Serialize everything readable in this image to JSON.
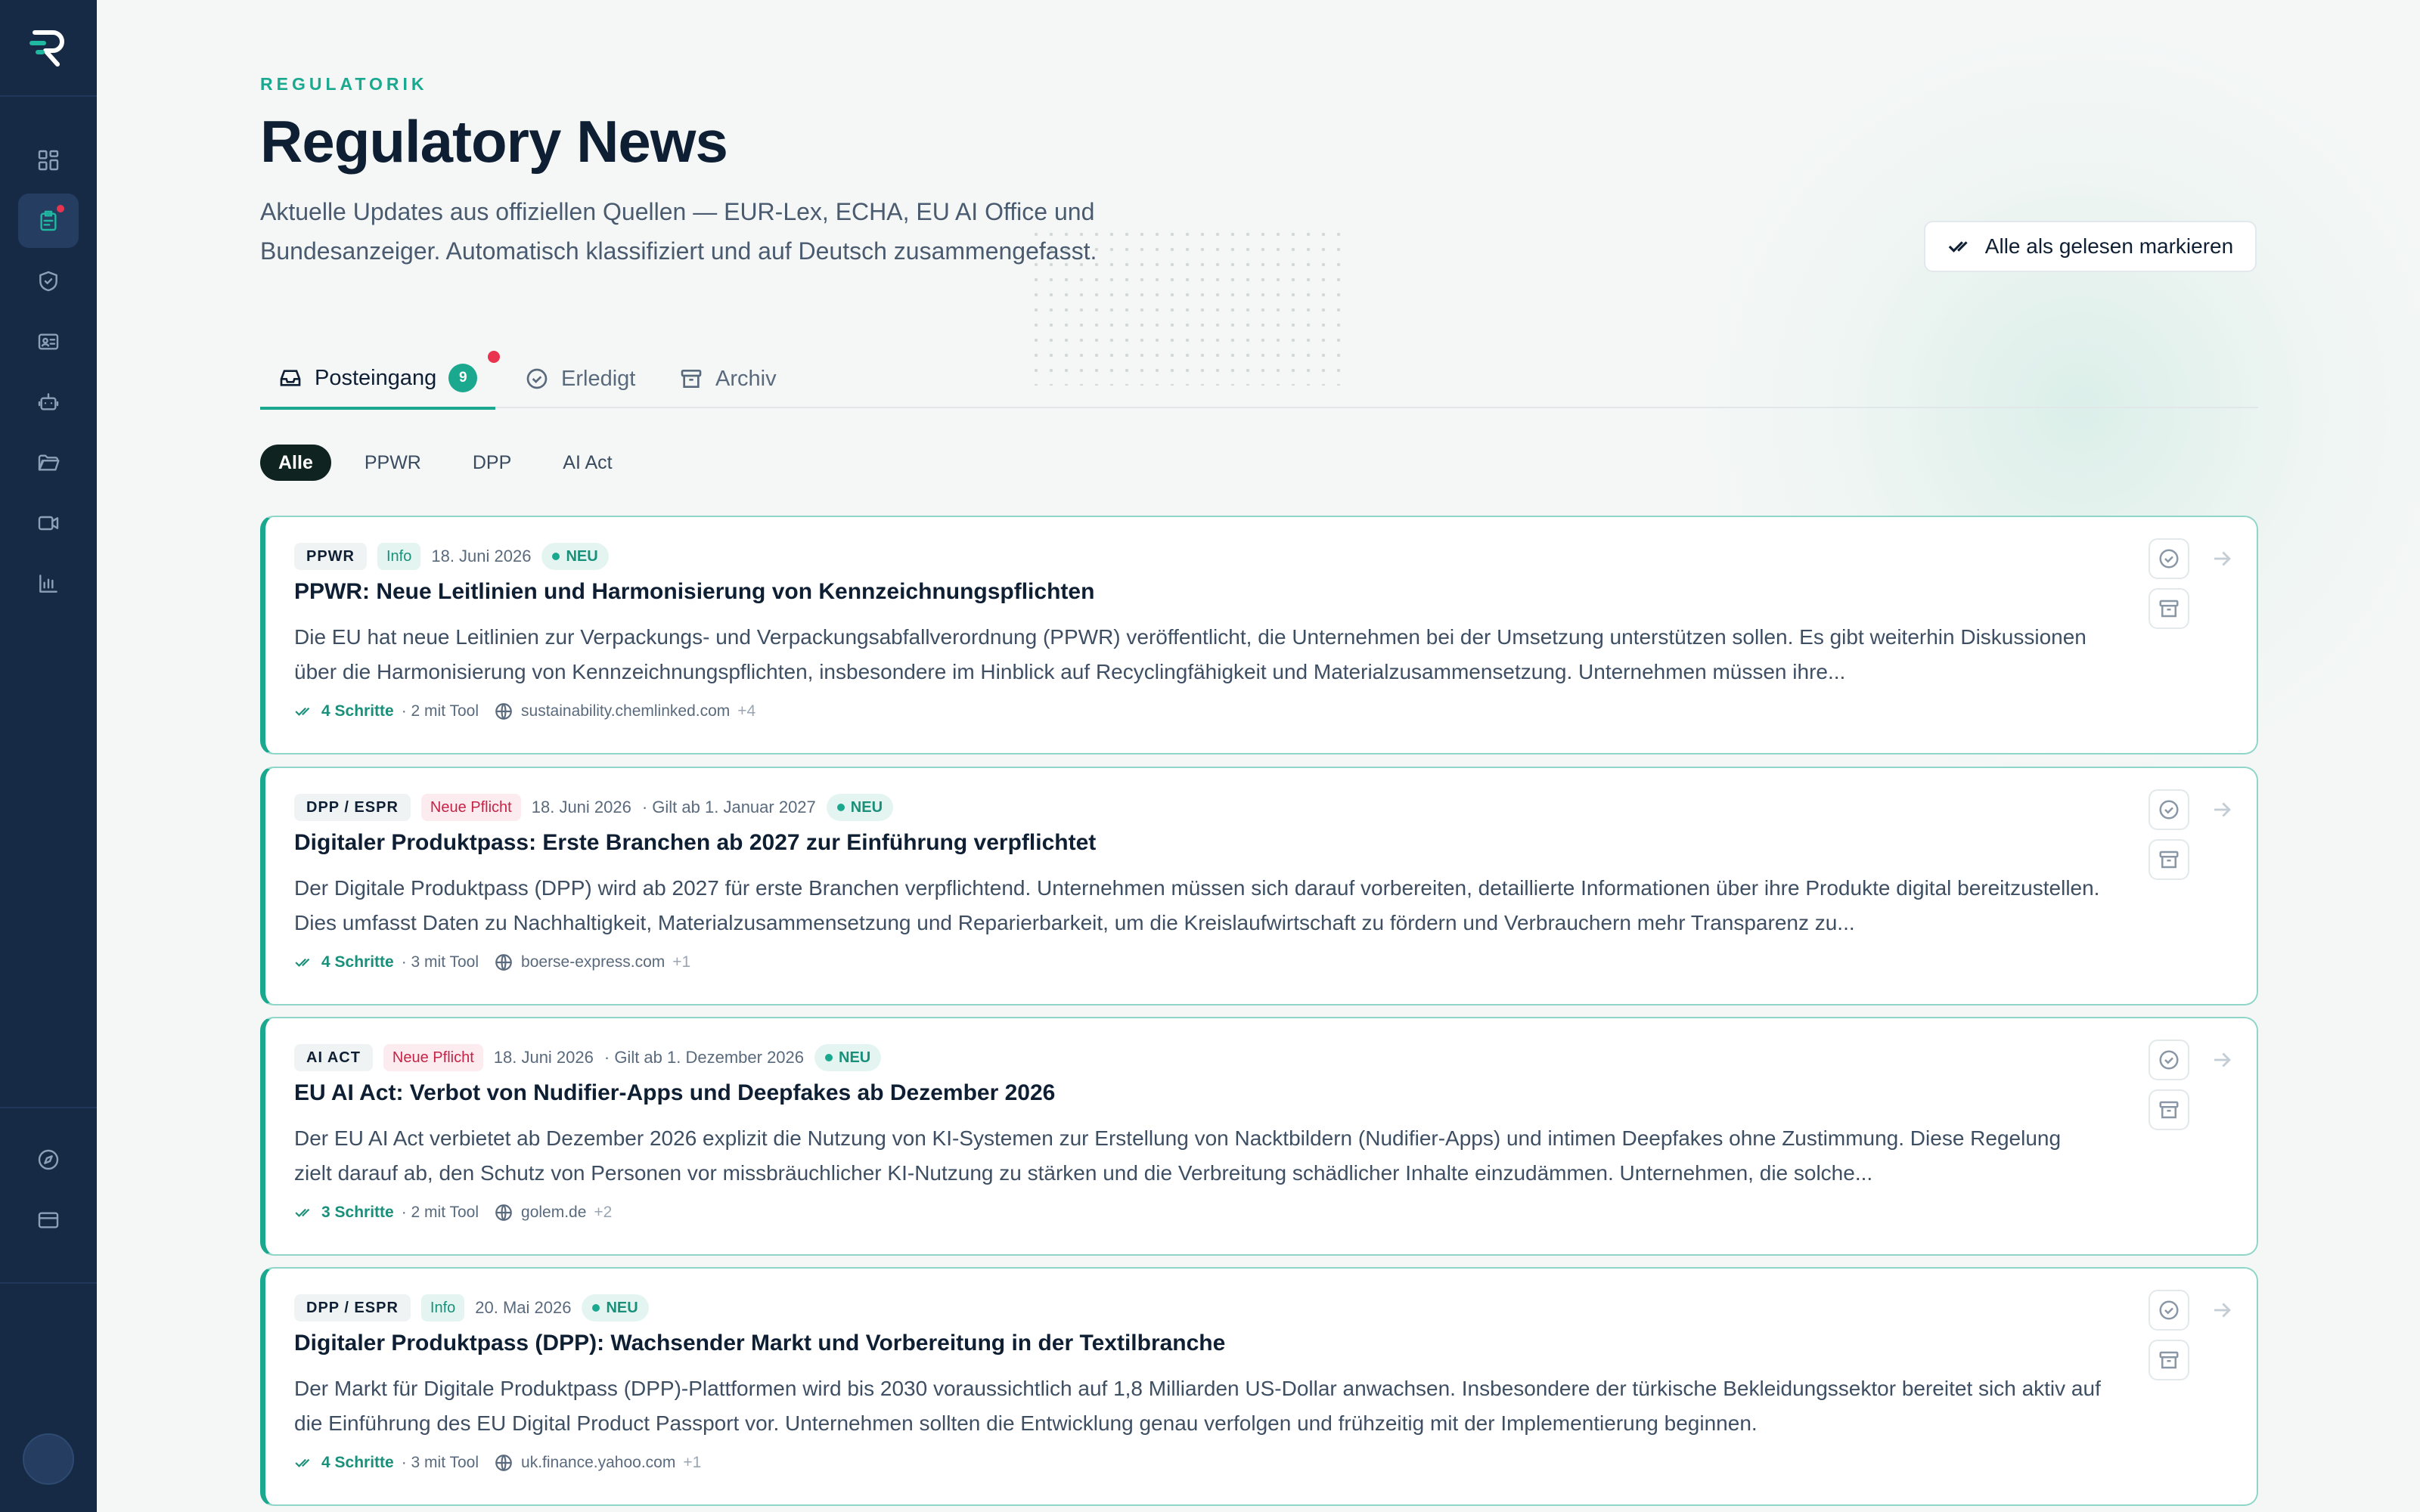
{
  "header": {
    "eyebrow": "REGULATORIK",
    "title": "Regulatory News",
    "subtitle": "Aktuelle Updates aus offiziellen Quellen — EUR-Lex, ECHA, EU AI Office und Bundesanzeiger. Automatisch klassifiziert und auf Deutsch zusammengefasst.",
    "mark_all_label": "Alle als gelesen markieren"
  },
  "tabs": [
    {
      "label": "Posteingang",
      "badge": "9",
      "icon": "inbox-icon"
    },
    {
      "label": "Erledigt",
      "icon": "check-circle-icon"
    },
    {
      "label": "Archiv",
      "icon": "archive-icon"
    }
  ],
  "filters": [
    "Alle",
    "PPWR",
    "DPP",
    "AI Act"
  ],
  "cards": [
    {
      "tag": "PPWR",
      "type": "Info",
      "date": "18. Juni 2026",
      "gilt": "",
      "status": "NEU",
      "title": "PPWR: Neue Leitlinien und Harmonisierung von Kennzeichnungspflichten",
      "desc": "Die EU hat neue Leitlinien zur Verpackungs- und Verpackungsabfallverordnung (PPWR) veröffentlicht, die Unternehmen bei der Umsetzung unterstützen sollen. Es gibt weiterhin Diskussionen über die Harmonisierung von Kennzeichnungspflichten, insbesondere im Hinblick auf Recyclingfähigkeit und Materialzusammensetzung. Unternehmen müssen ihre...",
      "steps": "4 Schritte",
      "tool": "· 2 mit Tool",
      "source": "sustainability.chemlinked.com",
      "more": "+4"
    },
    {
      "tag": "DPP / ESPR",
      "type": "Neue Pflicht",
      "date": "18. Juni 2026",
      "gilt": "· Gilt ab 1. Januar 2027",
      "status": "NEU",
      "title": "Digitaler Produktpass: Erste Branchen ab 2027 zur Einführung verpflichtet",
      "desc": "Der Digitale Produktpass (DPP) wird ab 2027 für erste Branchen verpflichtend. Unternehmen müssen sich darauf vorbereiten, detaillierte Informationen über ihre Produkte digital bereitzustellen. Dies umfasst Daten zu Nachhaltigkeit, Materialzusammensetzung und Reparierbarkeit, um die Kreislaufwirtschaft zu fördern und Verbrauchern mehr Transparenz zu...",
      "steps": "4 Schritte",
      "tool": "· 3 mit Tool",
      "source": "boerse-express.com",
      "more": "+1"
    },
    {
      "tag": "AI ACT",
      "type": "Neue Pflicht",
      "date": "18. Juni 2026",
      "gilt": "· Gilt ab 1. Dezember 2026",
      "status": "NEU",
      "title": "EU AI Act: Verbot von Nudifier-Apps und Deepfakes ab Dezember 2026",
      "desc": "Der EU AI Act verbietet ab Dezember 2026 explizit die Nutzung von KI-Systemen zur Erstellung von Nacktbildern (Nudifier-Apps) und intimen Deepfakes ohne Zustimmung. Diese Regelung zielt darauf ab, den Schutz von Personen vor missbräuchlicher KI-Nutzung zu stärken und die Verbreitung schädlicher Inhalte einzudämmen. Unternehmen, die solche...",
      "steps": "3 Schritte",
      "tool": "· 2 mit Tool",
      "source": "golem.de",
      "more": "+2"
    },
    {
      "tag": "DPP / ESPR",
      "type": "Info",
      "date": "20. Mai 2026",
      "gilt": "",
      "status": "NEU",
      "title": "Digitaler Produktpass (DPP): Wachsender Markt und Vorbereitung in der Textilbranche",
      "desc": "Der Markt für Digitale Produktpass (DPP)-Plattformen wird bis 2030 voraussichtlich auf 1,8 Milliarden US-Dollar anwachsen. Insbesondere der türkische Bekleidungssektor bereitet sich aktiv auf die Einführung des EU Digital Product Passport vor. Unternehmen sollten die Entwicklung genau verfolgen und frühzeitig mit der Implementierung beginnen.",
      "steps": "4 Schritte",
      "tool": "· 3 mit Tool",
      "source": "uk.finance.yahoo.com",
      "more": "+1"
    }
  ],
  "colors": {
    "accent": "#1aa88f",
    "sidebar": "#162a45",
    "alert": "#e8344e"
  }
}
